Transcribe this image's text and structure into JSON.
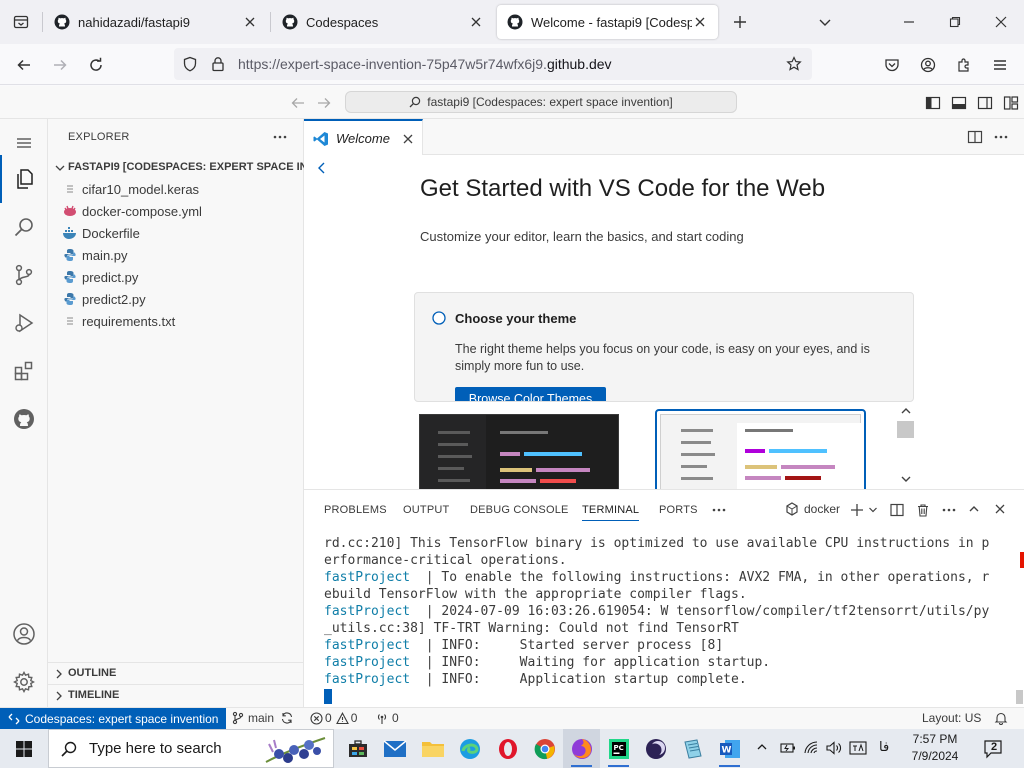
{
  "browser": {
    "tabs": [
      {
        "title": "nahidazadi/fastapi9",
        "active": false
      },
      {
        "title": "Codespaces",
        "active": false
      },
      {
        "title": "Welcome - fastapi9 [Codespaces",
        "active": true
      }
    ],
    "url_prefix": "https://expert-space-invention-75p47w5r74wfx6j9.",
    "url_domain": "github.dev"
  },
  "vscode": {
    "command_center": "fastapi9 [Codespaces: expert space invention]",
    "explorer": {
      "title": "EXPLORER",
      "folder": "FASTAPI9 [CODESPACES: EXPERT SPACE IN...",
      "files": [
        {
          "name": "cifar10_model.keras",
          "icon": "lines-file-icon"
        },
        {
          "name": "docker-compose.yml",
          "icon": "docker-compose-icon"
        },
        {
          "name": "Dockerfile",
          "icon": "docker-icon"
        },
        {
          "name": "main.py",
          "icon": "python-icon"
        },
        {
          "name": "predict.py",
          "icon": "python-icon"
        },
        {
          "name": "predict2.py",
          "icon": "python-icon"
        },
        {
          "name": "requirements.txt",
          "icon": "lines-file-icon"
        }
      ],
      "sections": [
        "OUTLINE",
        "TIMELINE"
      ]
    },
    "editor_tab": "Welcome",
    "welcome": {
      "title": "Get Started with VS Code for the Web",
      "subtitle": "Customize your editor, learn the basics, and start coding",
      "step_title": "Choose your theme",
      "step_desc": "The right theme helps you focus on your code, is easy on your eyes, and is simply more fun to use.",
      "step_button": "Browse Color Themes"
    },
    "panel": {
      "tabs": [
        "PROBLEMS",
        "OUTPUT",
        "DEBUG CONSOLE",
        "TERMINAL",
        "PORTS"
      ],
      "active_tab": "TERMINAL",
      "terminal_name": "docker",
      "lines": [
        {
          "svc": "",
          "text": "rd.cc:210] This TensorFlow binary is optimized to use available CPU instructions in p"
        },
        {
          "svc": "",
          "text": "erformance-critical operations."
        },
        {
          "svc": "fastProject",
          "text": "  | To enable the following instructions: AVX2 FMA, in other operations, r"
        },
        {
          "svc": "",
          "text": "ebuild TensorFlow with the appropriate compiler flags."
        },
        {
          "svc": "fastProject",
          "text": "  | 2024-07-09 16:03:26.619054: W tensorflow/compiler/tf2tensorrt/utils/py"
        },
        {
          "svc": "",
          "text": "_utils.cc:38] TF-TRT Warning: Could not find TensorRT"
        },
        {
          "svc": "fastProject",
          "text": "  | INFO:     Started server process [8]"
        },
        {
          "svc": "fastProject",
          "text": "  | INFO:     Waiting for application startup."
        },
        {
          "svc": "fastProject",
          "text": "  | INFO:     Application startup complete."
        }
      ]
    },
    "status": {
      "remote": "Codespaces: expert space invention",
      "branch": "main",
      "errors": "0",
      "warnings": "0",
      "ports": "0",
      "layout": "Layout: US"
    }
  },
  "taskbar": {
    "search_placeholder": "Type here to search",
    "lang": "فا",
    "time": "7:57 PM",
    "date": "7/9/2024",
    "notifications": "2"
  },
  "colors": {
    "accent": "#005fb8",
    "terminal_service": "#0f7ea8"
  }
}
